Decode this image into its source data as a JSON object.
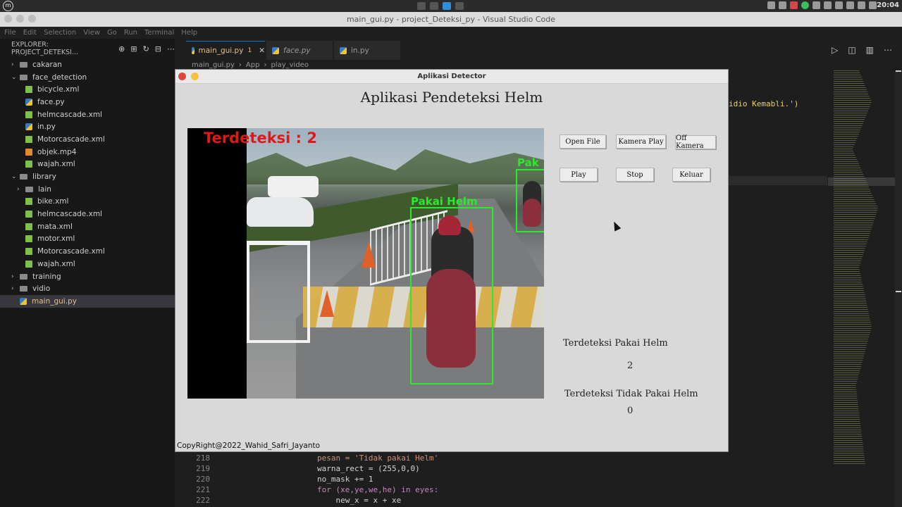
{
  "system": {
    "clock": "20:04"
  },
  "window": {
    "title": "main_gui.py - project_Deteksi_py - Visual Studio Code"
  },
  "menu": [
    "File",
    "Edit",
    "Selection",
    "View",
    "Go",
    "Run",
    "Terminal",
    "Help"
  ],
  "explorer": {
    "header": "EXPLORER: PROJECT_DETEKSI...",
    "items": [
      {
        "label": "cakaran",
        "type": "folder",
        "depth": 0,
        "chev": "›"
      },
      {
        "label": "face_detection",
        "type": "folder",
        "depth": 0,
        "chev": "⌄"
      },
      {
        "label": "bicycle.xml",
        "type": "xml",
        "depth": 1,
        "chev": ""
      },
      {
        "label": "face.py",
        "type": "py",
        "depth": 1,
        "chev": ""
      },
      {
        "label": "helmcascade.xml",
        "type": "xml",
        "depth": 1,
        "chev": ""
      },
      {
        "label": "in.py",
        "type": "py",
        "depth": 1,
        "chev": ""
      },
      {
        "label": "Motorcascade.xml",
        "type": "xml",
        "depth": 1,
        "chev": ""
      },
      {
        "label": "objek.mp4",
        "type": "mp4",
        "depth": 1,
        "chev": ""
      },
      {
        "label": "wajah.xml",
        "type": "xml",
        "depth": 1,
        "chev": ""
      },
      {
        "label": "library",
        "type": "folder",
        "depth": 0,
        "chev": "⌄"
      },
      {
        "label": "lain",
        "type": "folder",
        "depth": 1,
        "chev": "›"
      },
      {
        "label": "bike.xml",
        "type": "xml",
        "depth": 1,
        "chev": ""
      },
      {
        "label": "helmcascade.xml",
        "type": "xml",
        "depth": 1,
        "chev": ""
      },
      {
        "label": "mata.xml",
        "type": "xml",
        "depth": 1,
        "chev": ""
      },
      {
        "label": "motor.xml",
        "type": "xml",
        "depth": 1,
        "chev": ""
      },
      {
        "label": "Motorcascade.xml",
        "type": "xml",
        "depth": 1,
        "chev": ""
      },
      {
        "label": "wajah.xml",
        "type": "xml",
        "depth": 1,
        "chev": ""
      },
      {
        "label": "training",
        "type": "folder",
        "depth": 0,
        "chev": "›"
      },
      {
        "label": "vidio",
        "type": "folder",
        "depth": 0,
        "chev": "›"
      },
      {
        "label": "main_gui.py",
        "type": "py",
        "depth": 0,
        "chev": "",
        "active": true
      }
    ]
  },
  "tabs": [
    {
      "label": "main_gui.py",
      "badge": "1",
      "active": true
    },
    {
      "label": "face.py",
      "active": false
    },
    {
      "label": "in.py",
      "active": false
    }
  ],
  "breadcrumb": [
    "main_gui.py",
    "App",
    "play_video"
  ],
  "code": {
    "tail_text": "idio Kemabli.')",
    "lines": [
      {
        "no": "218",
        "text": "pesan = 'Tidak pakai Helm'"
      },
      {
        "no": "219",
        "text": "warna_rect = (255,0,0)"
      },
      {
        "no": "220",
        "text": "no_mask += 1"
      },
      {
        "no": "221",
        "text": "for (xe,ye,we,he) in eyes:"
      },
      {
        "no": "222",
        "text": "    new_x = x + xe"
      }
    ]
  },
  "app": {
    "window_title": "Aplikasi Detector",
    "heading": "Aplikasi Pendeteksi Helm",
    "overlay_count": "Terdeteksi : 2",
    "detection_label": "Pakai Helm",
    "detection_label_partial": "Pak",
    "buttons": {
      "open_file": "Open File",
      "kamera_play": "Kamera Play",
      "off_kamera": "Off Kamera",
      "play": "Play",
      "stop": "Stop",
      "keluar": "Keluar"
    },
    "stats": {
      "helm_label": "Terdeteksi Pakai Helm",
      "helm_value": "2",
      "no_helm_label": "Terdeteksi Tidak Pakai Helm",
      "no_helm_value": "0"
    },
    "copyright": "CopyRight@2022_Wahid_Safri_Jayanto"
  }
}
